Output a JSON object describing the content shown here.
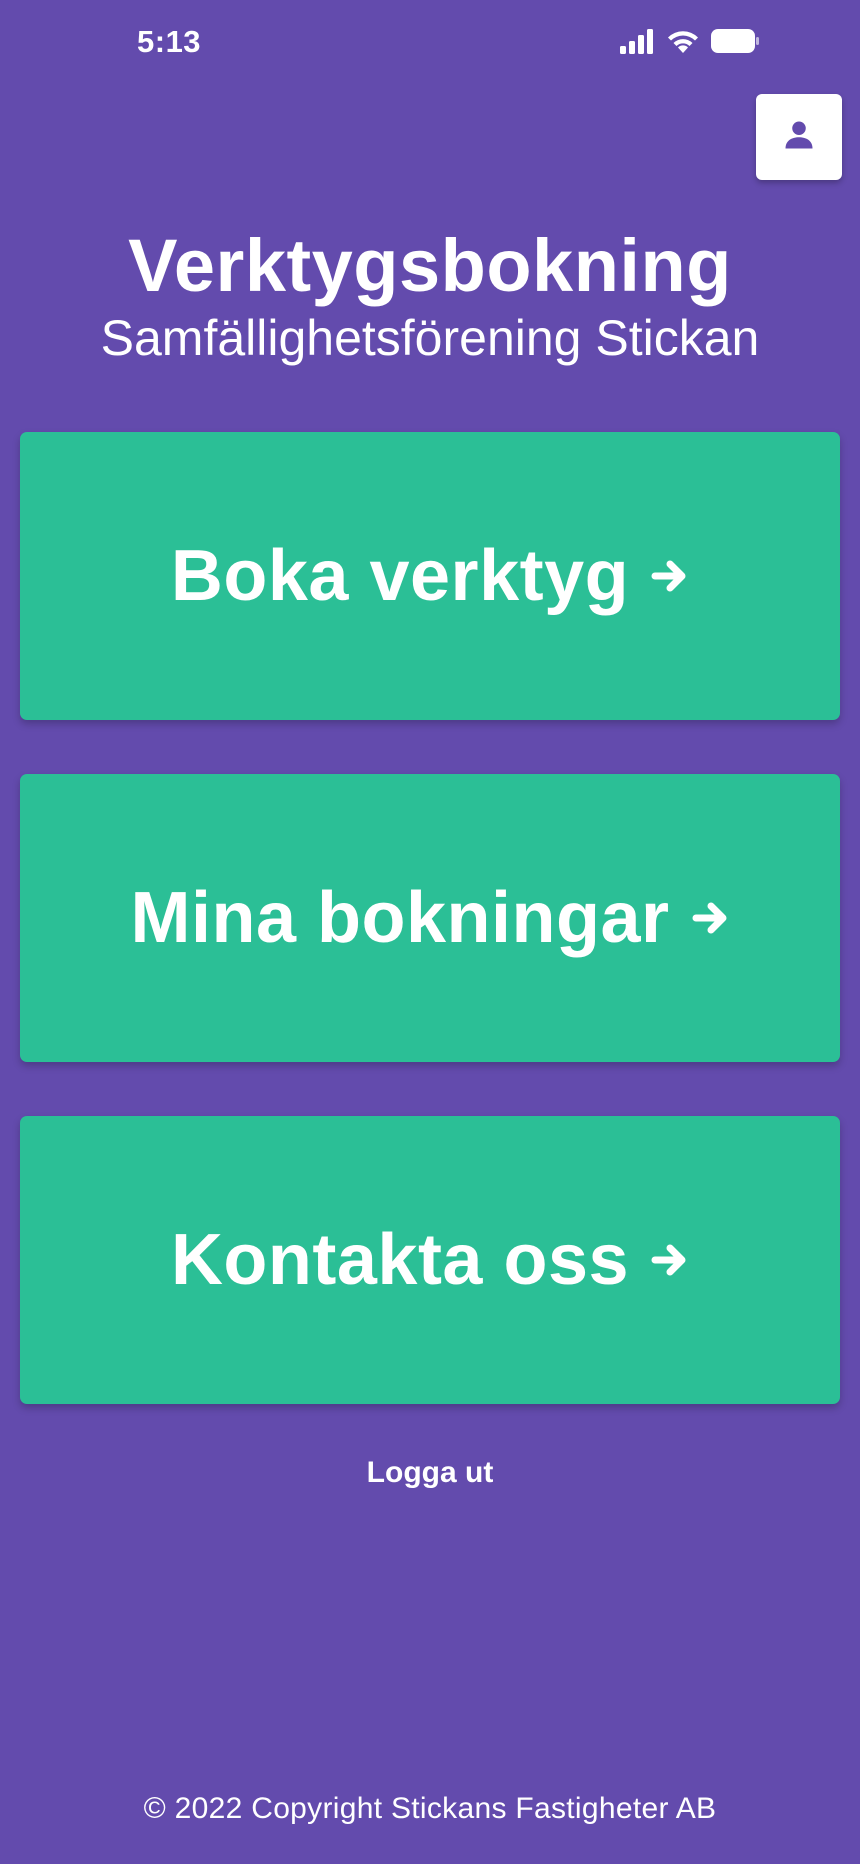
{
  "status_bar": {
    "time": "5:13",
    "icons": [
      "cellular-signal-icon",
      "wifi-icon",
      "battery-icon"
    ]
  },
  "header": {
    "profile_icon": "person-icon",
    "title": "Verktygsbokning",
    "subtitle": "Samfällighetsförening Stickan"
  },
  "menu": {
    "items": [
      {
        "label": "Boka verktyg",
        "icon": "arrow-right-icon"
      },
      {
        "label": "Mina bokningar",
        "icon": "arrow-right-icon"
      },
      {
        "label": "Kontakta oss",
        "icon": "arrow-right-icon"
      }
    ]
  },
  "logout_label": "Logga ut",
  "footer": {
    "copyright": "© 2022 Copyright Stickans Fastigheter AB"
  },
  "colors": {
    "background": "#634bad",
    "card": "#2bbf96",
    "text": "#ffffff",
    "profile_button_bg": "#ffffff",
    "profile_icon": "#634bad"
  }
}
